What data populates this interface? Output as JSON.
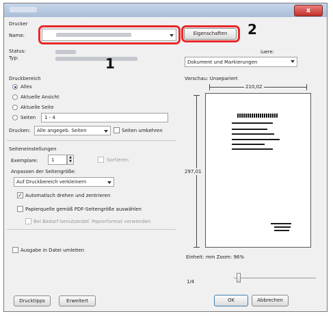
{
  "window": {
    "close_symbol": "x"
  },
  "drucker": {
    "group_label": "Drucker",
    "name_label": "Name:",
    "status_label": "Status:",
    "typ_label": "Typ:",
    "eigenschaften_label": "Eigenschaften",
    "right_label_partial": "iuere:",
    "kommentare_select": "Dokument und Markierungen"
  },
  "annotations": {
    "marker_1": "1",
    "marker_2": "2"
  },
  "druckbereich": {
    "group_label": "Druckbereich",
    "alles": "Alles",
    "aktuelle_ansicht": "Aktuelle Ansicht",
    "aktuelle_seite": "Aktuelle Seite",
    "seiten": "Seiten",
    "seiten_value": "1 - 4",
    "drucken_label": "Drucken:",
    "drucken_select": "Alle angegeb. Seiten",
    "seiten_umkehren": "Seiten umkehren"
  },
  "seiteneinstellungen": {
    "group_label": "Seiteneinstellungen",
    "exemplare_label": "Exemplare:",
    "exemplare_value": "1",
    "sortieren": "Sortieren",
    "anpassen_label": "Anpassen der Seitengröße:",
    "anpassen_select": "Auf Druckbereich verkleinern",
    "auto_drehen": "Automatisch drehen und zentrieren",
    "papierquelle": "Papierquelle gemäß PDF-Seitengröße auswählen",
    "bei_bedarf": "Bei Bedarf benutzerdef. Papierformat verwenden"
  },
  "ausgabe": "Ausgabe in Datei umleiten",
  "vorschau": {
    "label": "Vorschau: Unsepariert",
    "width_value": "210,02",
    "height_value": "297,01",
    "einheit": "Einheit: mm Zoom: 96%",
    "page_indicator": "1/4"
  },
  "buttons": {
    "drucktipps": "Drucktipps",
    "erweitert": "Erweitert",
    "ok": "OK",
    "abbrechen": "Abbrechen"
  }
}
